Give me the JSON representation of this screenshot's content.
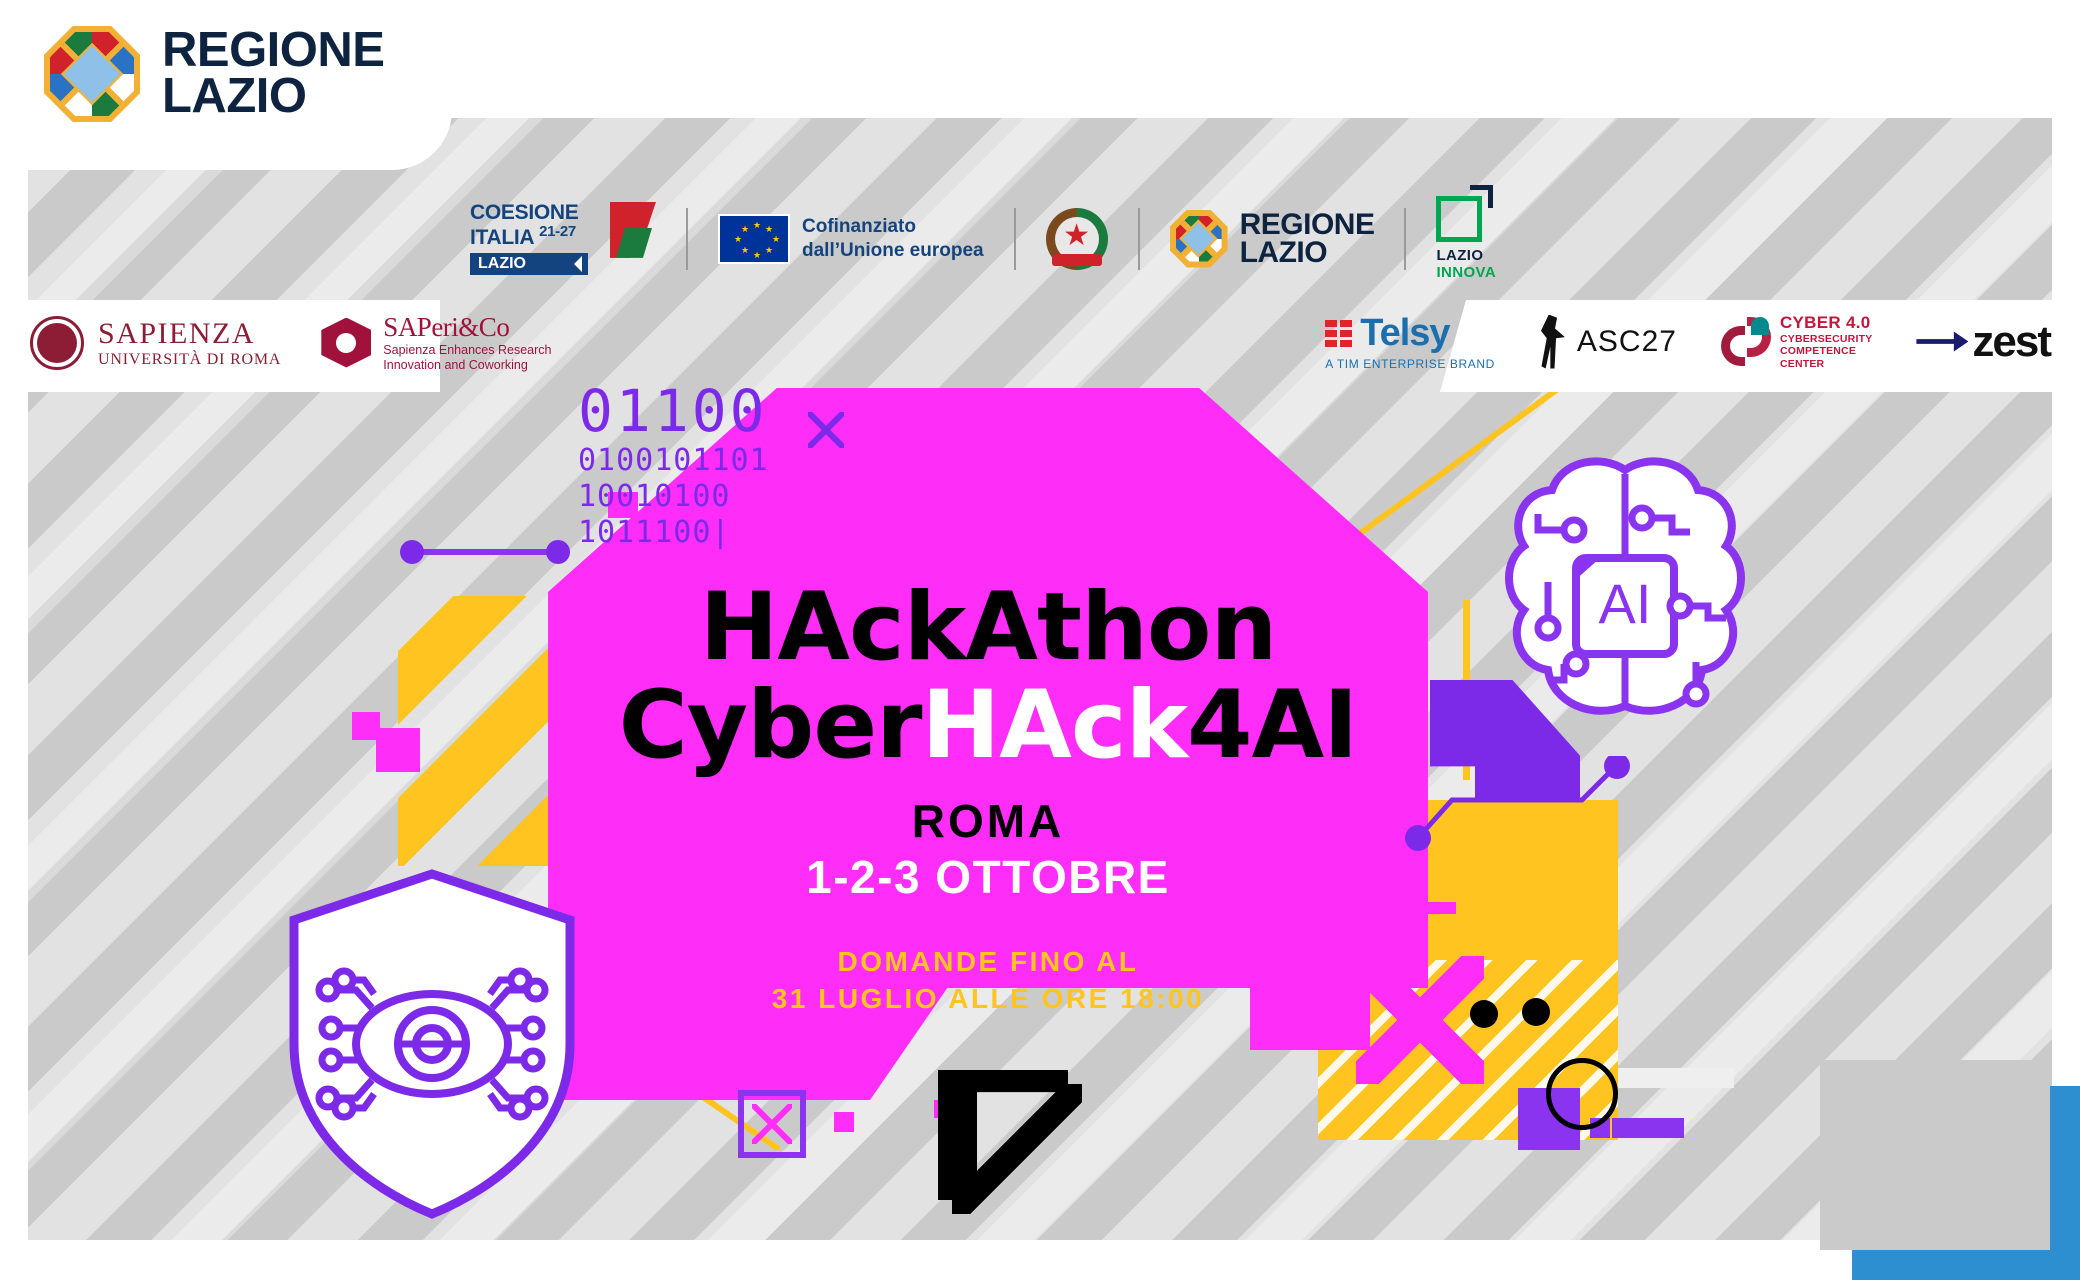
{
  "header": {
    "logo_line1": "REGIONE",
    "logo_line2": "LAZIO",
    "emblem_name": "regione-lazio-emblem"
  },
  "funding_bar": {
    "coesione": {
      "line1": "COESIONE",
      "line2": "ITALIA",
      "years": "21-27",
      "region_chip": "LAZIO"
    },
    "eu": {
      "line1": "Cofinanziato",
      "line2": "dall’Unione europea"
    },
    "republic": "repubblica-italiana-emblem",
    "regione": {
      "line1": "REGIONE",
      "line2": "LAZIO"
    },
    "lazio_innova": {
      "line1": "LAZIO",
      "line2": "INNOVA"
    }
  },
  "sponsors_left": [
    {
      "name": "Sapienza",
      "line1": "SAPIENZA",
      "line2": "UNIVERSITÀ DI ROMA"
    },
    {
      "name": "SAPeri&Co",
      "title": "SAPeri&Co",
      "line1": "Sapienza Enhances Research",
      "line2": "Innovation and Coworking"
    }
  ],
  "sponsors_right": [
    {
      "name": "Telsy",
      "title": "Telsy",
      "tagline": "A TIM ENTERPRISE BRAND"
    },
    {
      "name": "ASC27",
      "title": "ASC27"
    },
    {
      "name": "Cyber 4.0",
      "title": "CYBER 4.0",
      "line1": "CYBERSECURITY",
      "line2": "COMPETENCE",
      "line3": "CENTER"
    },
    {
      "name": "zest",
      "title": "zest"
    }
  ],
  "hero": {
    "binary": {
      "line1": "01100",
      "line2": "0100101101",
      "line3": "10010100",
      "line4": "1011100|"
    },
    "title_line1": "HAckAthon",
    "title_line2_a": "Cyber",
    "title_line2_b": "HAck",
    "title_line2_c": "4AI",
    "city": "ROMA",
    "dates": "1-2-3 OTTOBRE",
    "deadline_line1": "DOMANDE FINO AL",
    "deadline_line2": "31 LUGLIO ALLE ORE 18:00",
    "ai_chip_label": "AI"
  },
  "colors": {
    "pink": "#ff2df7",
    "purple": "#7d2ae8",
    "yellow": "#ffc41f",
    "blue": "#2e8fd0",
    "navy": "#0d2340",
    "grey_bg": "#cacaca"
  }
}
